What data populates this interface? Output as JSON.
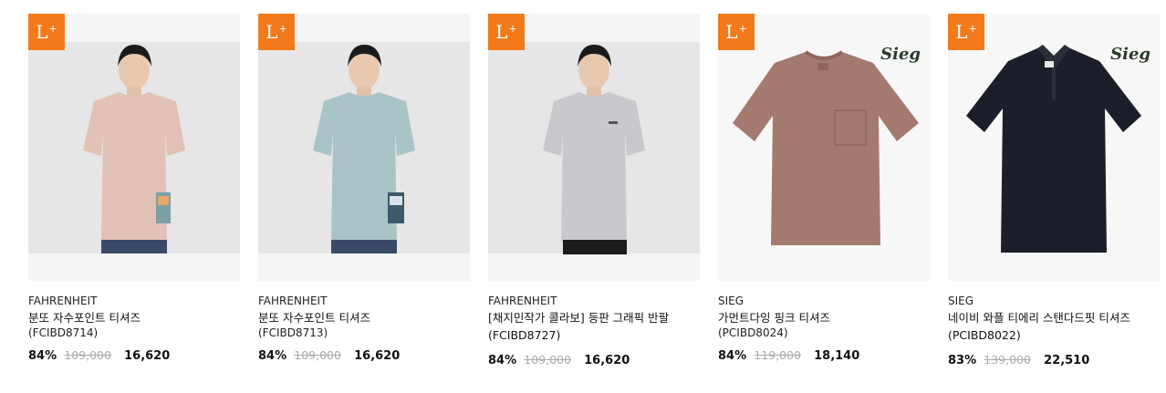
{
  "products": [
    {
      "badge": "L",
      "badge_sup": "+",
      "brand": "FAHRENHEIT",
      "name": "분또 자수포인트 티셔즈",
      "code": "(FCIBD8714)",
      "discount": "84%",
      "original_price": "109,000",
      "sale_price": "16,620",
      "shirt_color": "#e2c1b6",
      "image_type": "model"
    },
    {
      "badge": "L",
      "badge_sup": "+",
      "brand": "FAHRENHEIT",
      "name": "분또 자수포인트 티셔즈",
      "code": "(FCIBD8713)",
      "discount": "84%",
      "original_price": "109,000",
      "sale_price": "16,620",
      "shirt_color": "#a9c4c6",
      "image_type": "model"
    },
    {
      "badge": "L",
      "badge_sup": "+",
      "brand": "FAHRENHEIT",
      "name": "[채지민작가 콜라보] 등판 그래픽 반팔",
      "code": "(FCIBD8727)",
      "discount": "84%",
      "original_price": "109,000",
      "sale_price": "16,620",
      "shirt_color": "#c9c9cd",
      "image_type": "model"
    },
    {
      "badge": "L",
      "badge_sup": "+",
      "brand": "SIEG",
      "brand_logo": "Sieg",
      "name": "가먼트다잉 핑크 티셔즈",
      "code": "(PCIBD8024)",
      "discount": "84%",
      "original_price": "119,000",
      "sale_price": "18,140",
      "shirt_color": "#a47a70",
      "image_type": "packshot-tee"
    },
    {
      "badge": "L",
      "badge_sup": "+",
      "brand": "SIEG",
      "brand_logo": "Sieg",
      "name": "네이비 와플 티에리 스탠다드핏 티셔즈",
      "code": "(PCIBD8022)",
      "discount": "83%",
      "original_price": "139,000",
      "sale_price": "22,510",
      "shirt_color": "#1c1f29",
      "image_type": "packshot-polo"
    }
  ]
}
